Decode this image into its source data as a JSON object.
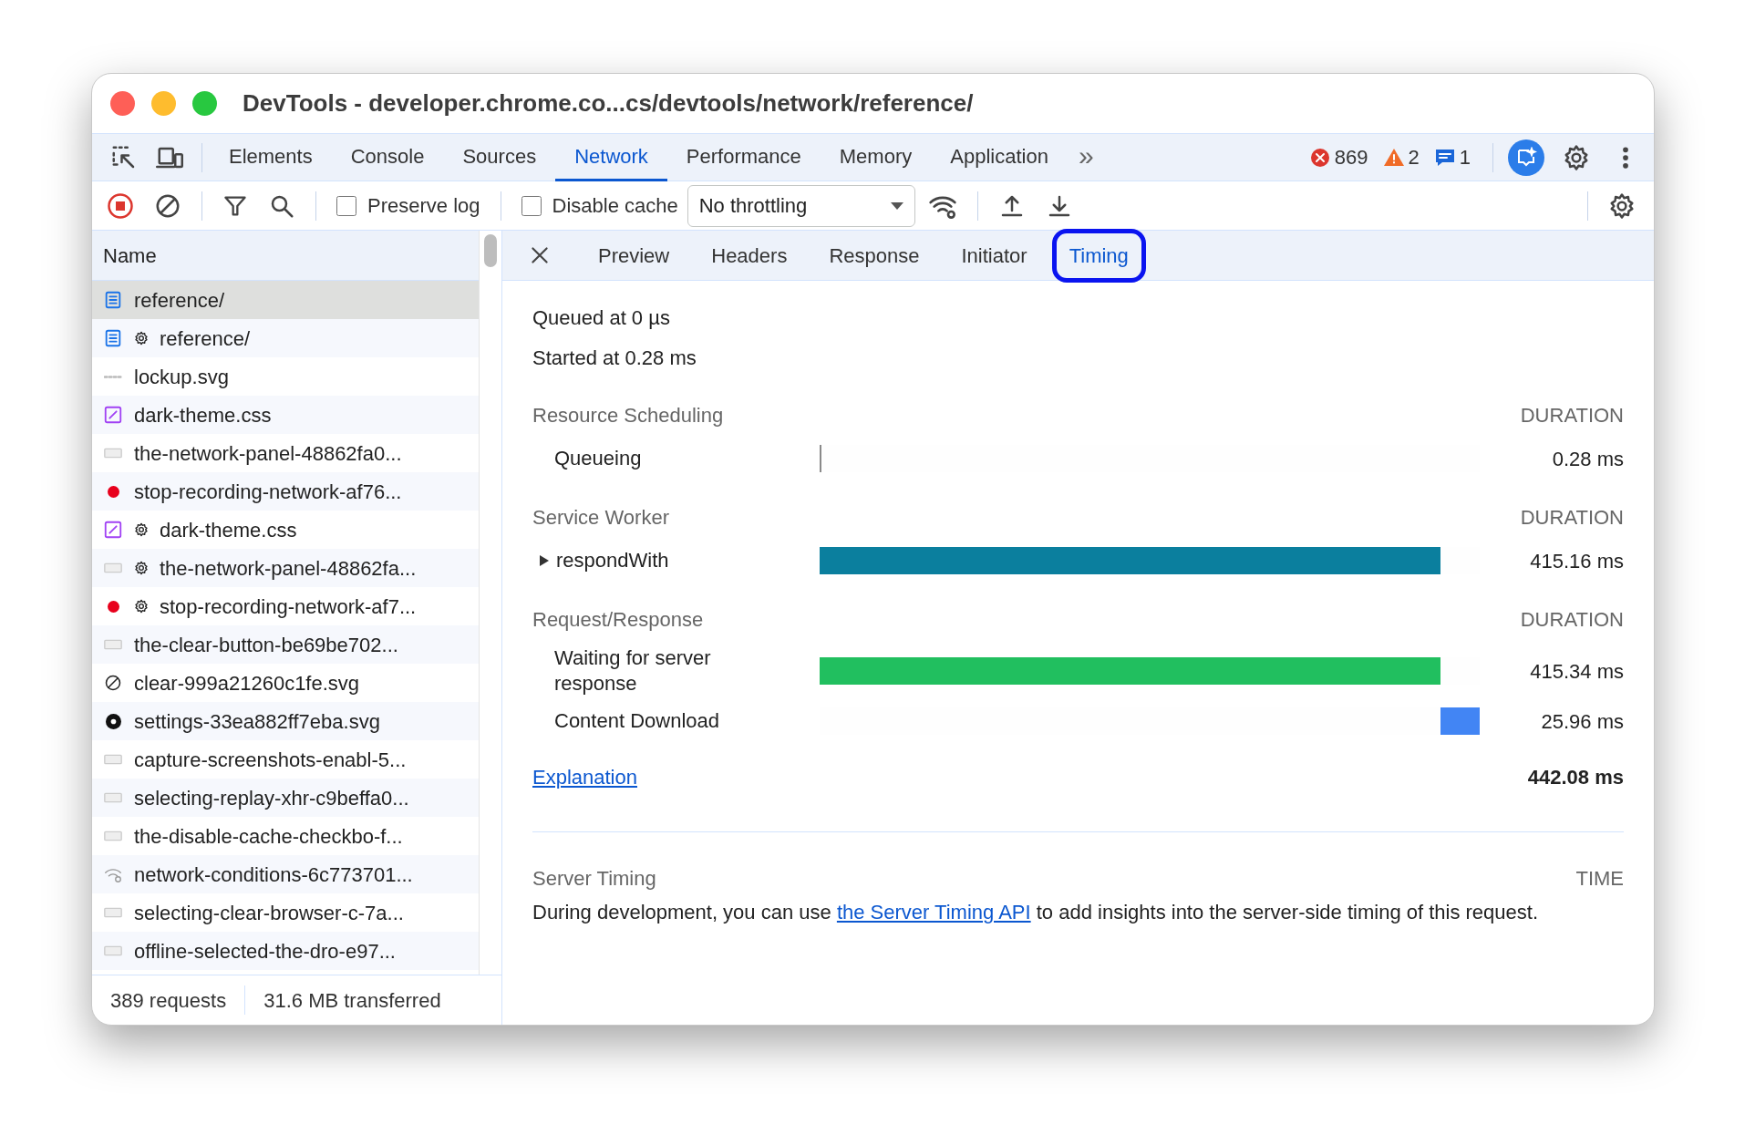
{
  "window": {
    "title": "DevTools - developer.chrome.co...cs/devtools/network/reference/"
  },
  "panel_tabs": [
    {
      "label": "Elements",
      "selected": false
    },
    {
      "label": "Console",
      "selected": false
    },
    {
      "label": "Sources",
      "selected": false
    },
    {
      "label": "Network",
      "selected": true
    },
    {
      "label": "Performance",
      "selected": false
    },
    {
      "label": "Memory",
      "selected": false
    },
    {
      "label": "Application",
      "selected": false
    }
  ],
  "more_tabs": "»",
  "counters": [
    {
      "kind": "error",
      "count": "869"
    },
    {
      "kind": "warning",
      "count": "2"
    },
    {
      "kind": "info",
      "count": "1"
    }
  ],
  "toolbar": {
    "recording": true,
    "preserve_log": {
      "label": "Preserve log",
      "checked": false
    },
    "disable_cache": {
      "label": "Disable cache",
      "checked": false
    },
    "throttling": "No throttling"
  },
  "requests_header": "Name",
  "requests": [
    {
      "name": "reference/",
      "kind": "document",
      "service_worker": false,
      "selected": true
    },
    {
      "name": "reference/",
      "kind": "document",
      "service_worker": true,
      "selected": false
    },
    {
      "name": "lockup.svg",
      "kind": "blank",
      "service_worker": false,
      "selected": false
    },
    {
      "name": "dark-theme.css",
      "kind": "stylesheet",
      "service_worker": false,
      "selected": false
    },
    {
      "name": "the-network-panel-48862fa0...",
      "kind": "image",
      "service_worker": false,
      "selected": false
    },
    {
      "name": "stop-recording-network-af76...",
      "kind": "dot",
      "service_worker": false,
      "selected": false
    },
    {
      "name": "dark-theme.css",
      "kind": "stylesheet",
      "service_worker": true,
      "selected": false
    },
    {
      "name": "the-network-panel-48862fa...",
      "kind": "image",
      "service_worker": true,
      "selected": false
    },
    {
      "name": "stop-recording-network-af7...",
      "kind": "dot",
      "service_worker": true,
      "selected": false
    },
    {
      "name": "the-clear-button-be69be702...",
      "kind": "image",
      "service_worker": false,
      "selected": false
    },
    {
      "name": "clear-999a21260c1fe.svg",
      "kind": "clear",
      "service_worker": false,
      "selected": false
    },
    {
      "name": "settings-33ea882ff7eba.svg",
      "kind": "gear",
      "service_worker": false,
      "selected": false
    },
    {
      "name": "capture-screenshots-enabl-5...",
      "kind": "image",
      "service_worker": false,
      "selected": false
    },
    {
      "name": "selecting-replay-xhr-c9beffa0...",
      "kind": "image",
      "service_worker": false,
      "selected": false
    },
    {
      "name": "the-disable-cache-checkbo-f...",
      "kind": "image",
      "service_worker": false,
      "selected": false
    },
    {
      "name": "network-conditions-6c773701...",
      "kind": "wifi",
      "service_worker": false,
      "selected": false
    },
    {
      "name": "selecting-clear-browser-c-7a...",
      "kind": "image",
      "service_worker": false,
      "selected": false
    },
    {
      "name": "offline-selected-the-dro-e97...",
      "kind": "image",
      "service_worker": false,
      "selected": false
    }
  ],
  "status_bar": [
    "389 requests",
    "31.6 MB transferred"
  ],
  "detail_tabs": [
    {
      "label": "Preview",
      "selected": false
    },
    {
      "label": "Headers",
      "selected": false
    },
    {
      "label": "Response",
      "selected": false
    },
    {
      "label": "Initiator",
      "selected": false
    },
    {
      "label": "Timing",
      "selected": true
    }
  ],
  "timing": {
    "queued": "Queued at 0 µs",
    "started": "Started at 0.28 ms",
    "sections": [
      {
        "title": "Resource Scheduling",
        "column": "DURATION",
        "rows": [
          {
            "label": "Queueing",
            "kind": "tick",
            "level": 0.003,
            "color": "#8a8a8a",
            "value": "0.28 ms"
          }
        ]
      },
      {
        "title": "Service Worker",
        "column": "DURATION",
        "rows": [
          {
            "label": "respondWith",
            "kind": "bar",
            "expanded": false,
            "level": 0.94,
            "color": "#0b7f9e",
            "value": "415.16 ms"
          }
        ]
      },
      {
        "title": "Request/Response",
        "column": "DURATION",
        "rows": [
          {
            "label": "Waiting for server response",
            "kind": "bar",
            "level": 0.94,
            "color": "#21bf5f",
            "value": "415.34 ms"
          },
          {
            "label": "Content Download",
            "kind": "bar",
            "level": 0.06,
            "color": "#4285f4",
            "value": "25.96 ms"
          }
        ]
      }
    ],
    "explanation": "Explanation",
    "total": "442.08 ms",
    "server_timing": {
      "title": "Server Timing",
      "column": "TIME",
      "before": "During development, you can use ",
      "link": "the Server Timing API",
      "after": " to add insights into the server-side timing of this request."
    }
  }
}
